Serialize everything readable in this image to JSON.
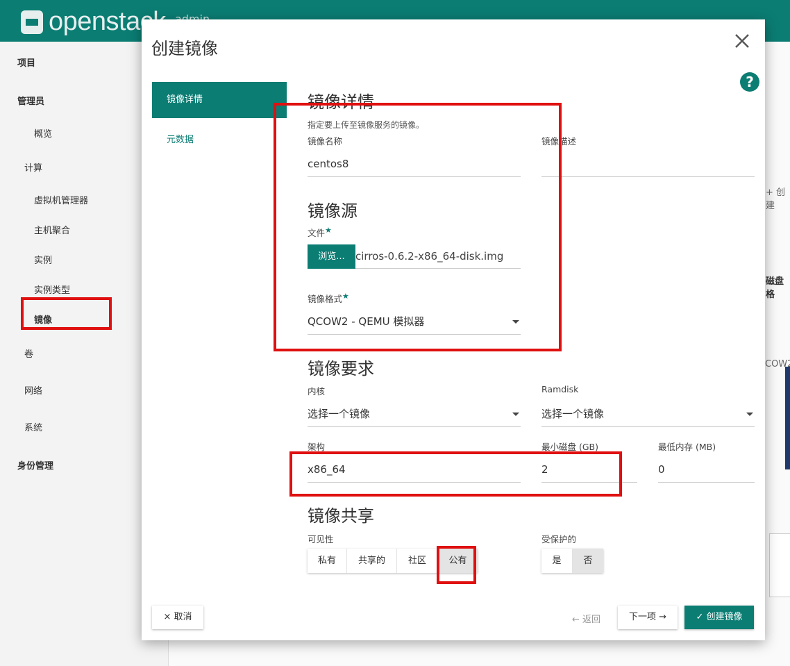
{
  "topbar": {
    "logo_text": "openstack",
    "project_text": "admin"
  },
  "sidebar": {
    "items": [
      {
        "label": "项目"
      },
      {
        "label": "管理员"
      },
      {
        "label": "概览"
      },
      {
        "label": "计算"
      },
      {
        "label": "虚拟机管理器"
      },
      {
        "label": "主机聚合"
      },
      {
        "label": "实例"
      },
      {
        "label": "实例类型"
      },
      {
        "label": "镜像"
      },
      {
        "label": "卷"
      },
      {
        "label": "网络"
      },
      {
        "label": "系统"
      },
      {
        "label": "身份管理"
      }
    ]
  },
  "background": {
    "create_fragment": "+ 创建",
    "disk_fragment": "磁盘格",
    "qcow_fragment": "COW2"
  },
  "modal": {
    "title": "创建镜像",
    "nav": {
      "details": "镜像详情",
      "metadata": "元数据"
    },
    "details_section": {
      "heading": "镜像详情",
      "description": "指定要上传至镜像服务的镜像。",
      "name_label": "镜像名称",
      "name_value": "centos8",
      "desc_label": "镜像描述",
      "desc_value": ""
    },
    "source_section": {
      "heading": "镜像源",
      "file_label": "文件",
      "required_mark": "★",
      "browse_label": "浏览...",
      "file_name": "cirros-0.6.2-x86_64-disk.img",
      "format_label": "镜像格式",
      "format_value": "QCOW2 - QEMU 模拟器"
    },
    "requirements_section": {
      "heading": "镜像要求",
      "kernel_label": "内核",
      "kernel_value": "选择一个镜像",
      "ramdisk_label": "Ramdisk",
      "ramdisk_value": "选择一个镜像",
      "arch_label": "架构",
      "arch_value": "x86_64",
      "min_disk_label": "最小磁盘 (GB)",
      "min_disk_value": "2",
      "min_ram_label": "最低内存 (MB)",
      "min_ram_value": "0"
    },
    "sharing_section": {
      "heading": "镜像共享",
      "visibility_label": "可见性",
      "visibility_options": [
        "私有",
        "共享的",
        "社区",
        "公有"
      ],
      "visibility_selected": "公有",
      "protected_label": "受保护的",
      "protected_options": [
        "是",
        "否"
      ],
      "protected_selected": "否"
    },
    "footer": {
      "cancel": "× 取消",
      "back": "← 返回",
      "next": "下一项 →",
      "create": "✓ 创建镜像"
    }
  },
  "colors": {
    "brand": "#0b7d73",
    "annotation": "#e01010"
  }
}
